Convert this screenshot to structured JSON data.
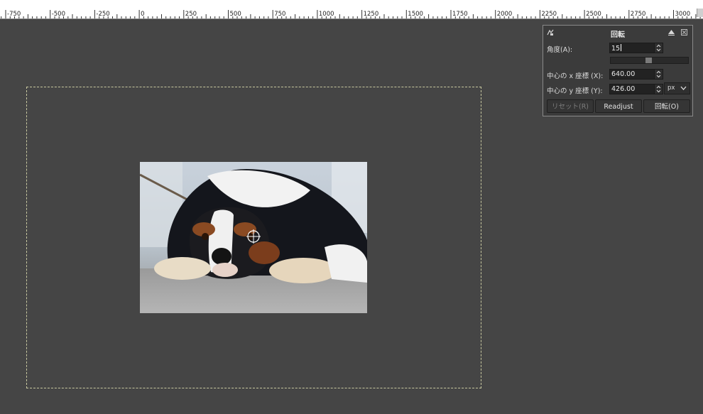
{
  "ruler": {
    "labels": [
      "-750",
      "-500",
      "-250",
      "0",
      "250",
      "500",
      "750",
      "1000",
      "1250",
      "1500",
      "1750",
      "2000",
      "2250",
      "2500",
      "2750",
      "3000"
    ]
  },
  "dialog": {
    "title": "回転",
    "angle_label": "角度(A):",
    "angle_value": "15",
    "center_x_label": "中心の x 座標 (X):",
    "center_x_value": "640.00",
    "center_y_label": "中心の y 座標 (Y):",
    "center_y_value": "426.00",
    "unit": "px",
    "buttons": {
      "reset": "リセット(R)",
      "readjust": "Readjust",
      "rotate": "回転(O)"
    }
  },
  "colors": {
    "canvas_bg": "#454545",
    "dialog_bg": "#3b3b3b",
    "layer_boundary": "#c8c8a0"
  }
}
